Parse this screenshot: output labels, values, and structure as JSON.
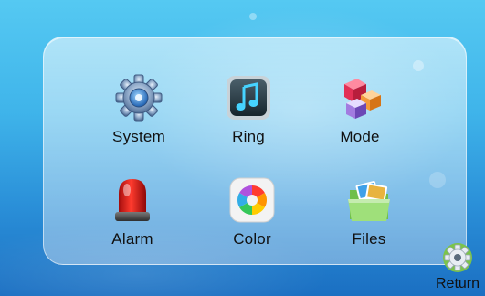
{
  "menu": {
    "items": [
      {
        "label": "System",
        "icon": "gear-icon"
      },
      {
        "label": "Ring",
        "icon": "music-note-icon"
      },
      {
        "label": "Mode",
        "icon": "cubes-icon"
      },
      {
        "label": "Alarm",
        "icon": "siren-icon"
      },
      {
        "label": "Color",
        "icon": "color-wheel-icon"
      },
      {
        "label": "Files",
        "icon": "folder-photos-icon"
      }
    ]
  },
  "nav": {
    "return_label": "Return",
    "return_icon": "return-gear-icon"
  },
  "colors": {
    "background_top": "#55c9f2",
    "background_bottom": "#1b6fc2",
    "label_text": "#111111"
  }
}
